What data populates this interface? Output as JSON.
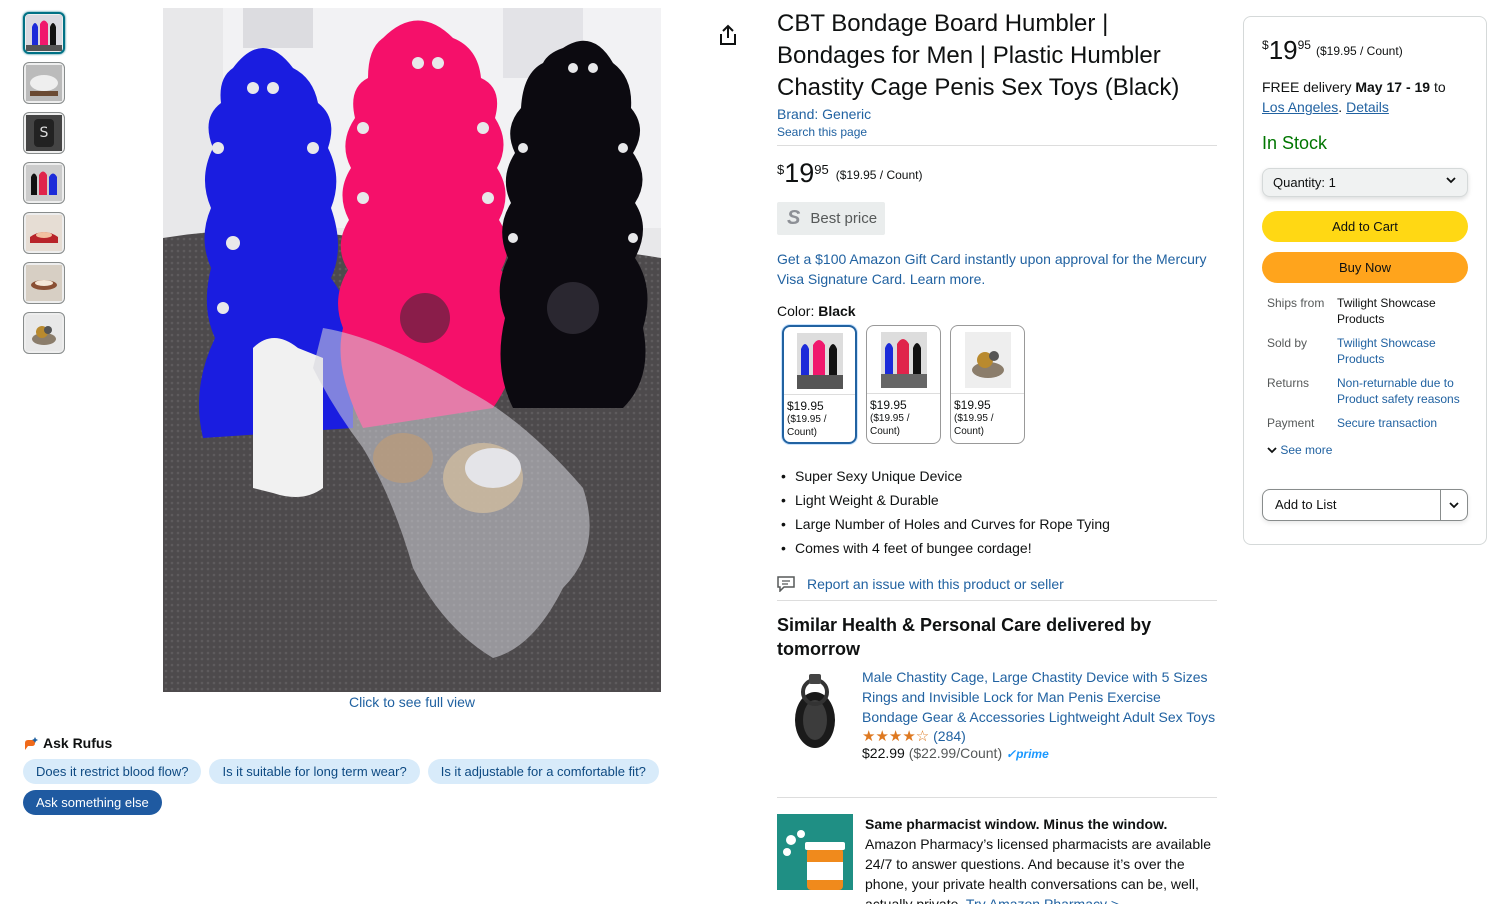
{
  "thumbnails": [
    {
      "icon": "pink-blue-black-boards"
    },
    {
      "icon": "product-in-use"
    },
    {
      "icon": "board-s-logo"
    },
    {
      "icon": "blue-red-black-boards"
    },
    {
      "icon": "board-on-bed-red"
    },
    {
      "icon": "board-in-hands"
    },
    {
      "icon": "cage-on-stone"
    }
  ],
  "main_image": {
    "full_view_label": "Click to see full view"
  },
  "rufus": {
    "title": "Ask Rufus",
    "chips": [
      "Does it restrict blood flow?",
      "Is it suitable for long term wear?",
      "Is it adjustable for a comfortable fit?"
    ],
    "ask_else": "Ask something else"
  },
  "product": {
    "title": "CBT Bondage Board Humbler | Bondages for Men | Plastic Humbler Chastity Cage Penis Sex Toys (Black)",
    "brand": "Brand: Generic",
    "search_page": "Search this page",
    "price_currency": "$",
    "price_whole": "19",
    "price_fraction": "95",
    "price_unit": "($19.95 / Count)",
    "best_price_icon": "S",
    "best_price": "Best price",
    "promo": "Get a $100 Amazon Gift Card instantly upon approval for the Mercury Visa Signature Card. Learn more.",
    "color_label": "Color: ",
    "color_value": "Black",
    "swatches": [
      {
        "price": "$19.95",
        "unit": "($19.95 / Count)"
      },
      {
        "price": "$19.95",
        "unit": "($19.95 / Count)"
      },
      {
        "price": "$19.95",
        "unit": "($19.95 / Count)"
      }
    ],
    "bullets": [
      "Super Sexy Unique Device",
      "Light Weight & Durable",
      "Large Number of Holes and Curves for Rope Tying",
      "Comes with 4 feet of bungee cordage!"
    ],
    "report": "Report an issue with this product or seller"
  },
  "similar": {
    "heading": "Similar Health & Personal Care delivered by tomorrow",
    "item": {
      "title": "Male Chastity Cage, Large Chastity Device with 5 Sizes Rings and Invisible Lock for Man Penis Exercise Bondage Gear & Accessories Lightweight Adult Sex Toys",
      "stars": "★★★★☆",
      "rating_count": "(284)",
      "price": "$22.99",
      "unit": "($22.99/Count)",
      "prime_check": "✓",
      "prime": "prime"
    }
  },
  "pharmacy": {
    "headline": "Same pharmacist window. Minus the window.",
    "body": "Amazon Pharmacy’s licensed pharmacists are available 24/7 to answer questions. And because it’s over the phone, your private health conversations can be, well, actually private.",
    "link": "Try Amazon Pharmacy >"
  },
  "buybox": {
    "price_currency": "$",
    "price_whole": "19",
    "price_fraction": "95",
    "price_unit": "($19.95 / Count)",
    "delivery_prefix": "FREE delivery ",
    "delivery_date": "May 17 - 19",
    "delivery_to": " to",
    "location": "Los Angeles",
    "details": "Details",
    "stock": "In Stock",
    "quantity": "Quantity:  1",
    "add_to_cart": "Add to Cart",
    "buy_now": "Buy Now",
    "info": [
      {
        "k": "Ships from",
        "v": "Twilight Showcase Products",
        "link": false
      },
      {
        "k": "Sold by",
        "v": "Twilight Showcase Products",
        "link": true
      },
      {
        "k": "Returns",
        "v": "Non-returnable due to Product safety reasons",
        "link": true
      },
      {
        "k": "Payment",
        "v": "Secure transaction",
        "link": true
      }
    ],
    "see_more": "See more",
    "add_to_list": "Add to List"
  },
  "colors": {
    "link": "#2162a1",
    "stock": "#007600",
    "cart": "#ffd814",
    "buy": "#ffa41c"
  }
}
